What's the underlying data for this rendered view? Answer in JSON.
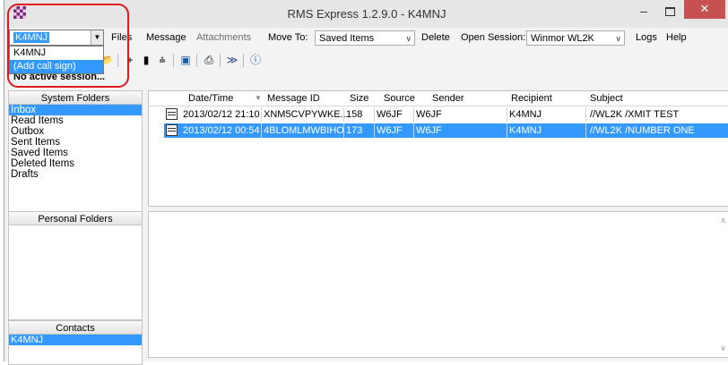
{
  "window": {
    "title": "RMS Express 1.2.9.0 - K4MNJ",
    "minimize": "–",
    "close": "✕"
  },
  "menu": {
    "files": "Files",
    "message": "Message",
    "attachments": "Attachments",
    "move_to": "Move To:",
    "move_target": "Saved Items",
    "delete": "Delete",
    "open_session": "Open Session:",
    "session_type": "Winmor WL2K",
    "logs": "Logs",
    "help": "Help"
  },
  "callsign": {
    "selected": "K4MNJ",
    "options": [
      "K4MNJ",
      "(Add call sign)"
    ]
  },
  "status_text": "No active session...",
  "toolbar_icons": [
    "open-icon",
    "add-icon",
    "notes-icon",
    "route-icon",
    "save-icon",
    "print-icon",
    "forward-icon",
    "help-icon"
  ],
  "system_folders": {
    "header": "System Folders",
    "items": [
      "Inbox",
      "Read Items",
      "Outbox",
      "Sent Items",
      "Saved Items",
      "Deleted Items",
      "Drafts"
    ],
    "selected": "Inbox"
  },
  "personal_folders": {
    "header": "Personal Folders"
  },
  "contacts": {
    "header": "Contacts",
    "items": [
      "K4MNJ"
    ]
  },
  "columns": [
    "Date/Time",
    "Message ID",
    "Size",
    "Source",
    "Sender",
    "Recipient",
    "Subject"
  ],
  "messages": [
    {
      "datetime": "2013/02/12 21:10",
      "id": "XNM5CVPYWKE...",
      "size": "158",
      "source": "W6JF",
      "sender": "W6JF",
      "recipient": "K4MNJ",
      "subject": "//WL2K /XMIT TEST"
    },
    {
      "datetime": "2013/02/12 00:54",
      "id": "4BLOMLMWBIHO",
      "size": "173",
      "source": "W6JF",
      "sender": "W6JF",
      "recipient": "K4MNJ",
      "subject": "//WL2K /NUMBER ONE"
    }
  ],
  "colors": {
    "selection": "#3399ff",
    "close": "#c75050",
    "highlight_box": "#e0181c"
  }
}
